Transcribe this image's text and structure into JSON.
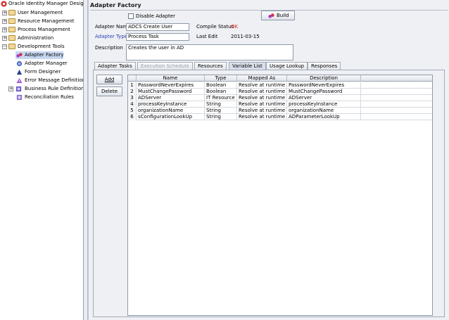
{
  "tree": {
    "root": "Oracle Identity Manager Design Co",
    "items": [
      {
        "label": "User Management"
      },
      {
        "label": "Resource Management"
      },
      {
        "label": "Process Management"
      },
      {
        "label": "Administration"
      },
      {
        "label": "Development Tools"
      },
      {
        "label": "Adapter Factory"
      },
      {
        "label": "Adapter Manager"
      },
      {
        "label": "Form Designer"
      },
      {
        "label": "Error Message Definition"
      },
      {
        "label": "Business Rule Definition"
      },
      {
        "label": "Reconciliation Rules"
      }
    ]
  },
  "panel": {
    "title": "Adapter Factory",
    "disable_adapter_label": "Disable Adapter",
    "build_label": "Build",
    "adapter_name_label": "Adapter Name",
    "adapter_name_value": "ADCS Create User",
    "compile_status_label": "Compile Status",
    "compile_status_value": "OK",
    "adapter_type_label": "Adapter Type",
    "adapter_type_value": "Process Task",
    "last_edit_label": "Last Edit",
    "last_edit_value": "2011-03-15",
    "description_label": "Description",
    "description_value": "Creates the user in AD"
  },
  "tabs": [
    {
      "label": "Adapter Tasks"
    },
    {
      "label": "Execution Schedule"
    },
    {
      "label": "Resources"
    },
    {
      "label": "Variable List"
    },
    {
      "label": "Usage Lookup"
    },
    {
      "label": "Responses"
    }
  ],
  "buttons": {
    "add": "Add",
    "delete": "Delete"
  },
  "table": {
    "columns": [
      "",
      "Name",
      "Type",
      "Mapped As",
      "Description"
    ],
    "rows": [
      {
        "n": "1",
        "name": "PasswordNeverExpires",
        "type": "Boolean",
        "mapped": "Resolve at runtime",
        "desc": "PasswordNeverExpires"
      },
      {
        "n": "2",
        "name": "MustChangePassword",
        "type": "Boolean",
        "mapped": "Resolve at runtime",
        "desc": "MustChangePassword"
      },
      {
        "n": "3",
        "name": "ADServer",
        "type": "IT Resource",
        "mapped": "Resolve at runtime",
        "desc": "ADServer"
      },
      {
        "n": "4",
        "name": "processKeyInstance",
        "type": "String",
        "mapped": "Resolve at runtime",
        "desc": "processKeyInstance"
      },
      {
        "n": "5",
        "name": "organizationName",
        "type": "String",
        "mapped": "Resolve at runtime",
        "desc": "organizationName"
      },
      {
        "n": "6",
        "name": "sConfigurationLookUp",
        "type": "String",
        "mapped": "Resolve at runtime",
        "desc": "ADParameterLookUp"
      }
    ]
  },
  "colors": {
    "compile_ok": "#e0201b",
    "adapter_type_label": "#2b3fb7",
    "selected_bg": "#c8d7f2"
  }
}
